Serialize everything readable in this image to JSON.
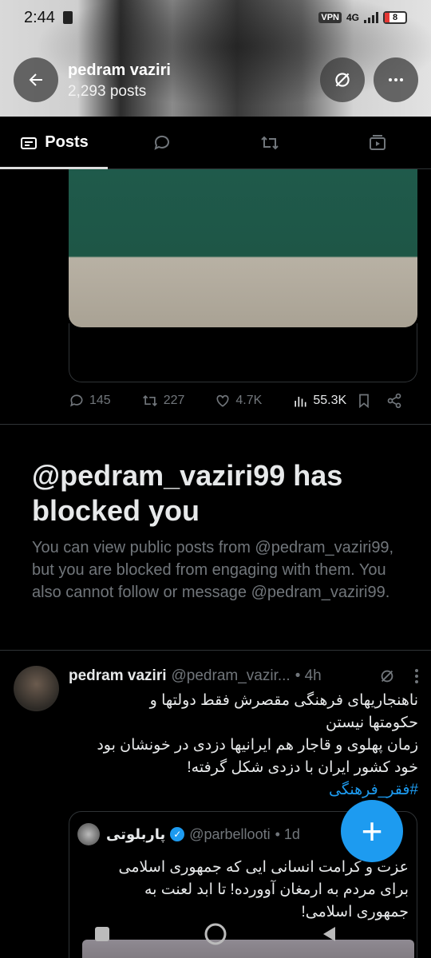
{
  "status_bar": {
    "time": "2:44",
    "network": "4G",
    "vpn": "VPN",
    "battery": "8"
  },
  "header": {
    "name": "pedram vaziri",
    "post_count": "2,293 posts"
  },
  "tabs": [
    {
      "label": "Posts",
      "icon": "posts-icon",
      "active": true
    },
    {
      "label": "",
      "icon": "reply-icon",
      "active": false
    },
    {
      "label": "",
      "icon": "repost-icon",
      "active": false
    },
    {
      "label": "",
      "icon": "media-icon",
      "active": false
    }
  ],
  "prev_post": {
    "replies": "145",
    "reposts": "227",
    "likes": "4.7K",
    "views": "55.3K"
  },
  "blocked": {
    "title": "@pedram_vaziri99 has blocked you",
    "message": "You can view public posts from @pedram_vaziri99, but you are blocked from engaging with them. You also cannot follow or message @pedram_vaziri99."
  },
  "tweet": {
    "name": "pedram vaziri",
    "handle": "@pedram_vazir...",
    "time": "• 4h",
    "lines": [
      "ناهنجاریهای فرهنگی مقصرش فقط دولتها و",
      "حکومتها نیستن",
      "زمان پهلوی و قاجار هم ایرانیها دزدی در خونشان بود",
      "خود کشور ایران با دزدی شکل گرفته!"
    ],
    "hashtag": "#فقر_فرهنگی"
  },
  "quoted": {
    "name": "پاربلوتی",
    "handle": "@parbellooti",
    "time": "• 1d",
    "lines": [
      "عزت و کرامت انسانی ایی که جمهوری اسلامی",
      "برای مردم به ارمغان آوورده! تا ابد لعنت به",
      "جمهوری اسلامی!"
    ]
  },
  "fab": {
    "label": "+"
  },
  "colors": {
    "accent": "#1d9bf0",
    "muted": "#71767b",
    "text": "#e7e9ea",
    "background": "#000000"
  }
}
